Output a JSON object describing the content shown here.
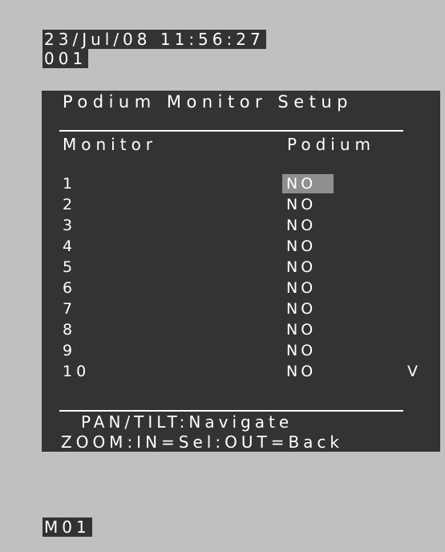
{
  "status": {
    "datetime": "23/Jul/08 11:56:27",
    "camera_id": "001",
    "monitor_id": "M01"
  },
  "menu": {
    "title": "Podium Monitor Setup",
    "columns": {
      "monitor": "Monitor",
      "podium": "Podium"
    },
    "rows": [
      {
        "monitor": "1",
        "podium": "NO",
        "selected": true
      },
      {
        "monitor": "2",
        "podium": "NO",
        "selected": false
      },
      {
        "monitor": "3",
        "podium": "NO",
        "selected": false
      },
      {
        "monitor": "4",
        "podium": "NO",
        "selected": false
      },
      {
        "monitor": "5",
        "podium": "NO",
        "selected": false
      },
      {
        "monitor": "6",
        "podium": "NO",
        "selected": false
      },
      {
        "monitor": "7",
        "podium": "NO",
        "selected": false
      },
      {
        "monitor": "8",
        "podium": "NO",
        "selected": false
      },
      {
        "monitor": "9",
        "podium": "NO",
        "selected": false
      },
      {
        "monitor": "10",
        "podium": "NO",
        "selected": false
      }
    ],
    "scroll_indicator": "V",
    "help_line_1": "PAN/TILT:Navigate",
    "help_line_2": "ZOOM:IN=Sel:OUT=Back"
  },
  "colors": {
    "background": "#c0c0c0",
    "panel": "#333333",
    "text": "#ffffff",
    "selection": "#8f8f8f"
  }
}
